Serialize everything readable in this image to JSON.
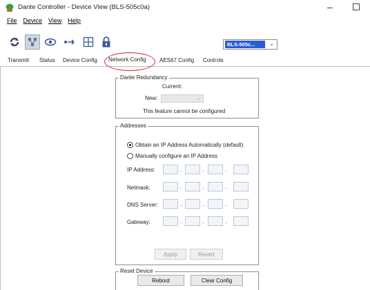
{
  "window": {
    "title": "Dante Controller - Device View (BLS-505c0a)",
    "minimize_glyph": "–"
  },
  "menu": {
    "items": [
      "File",
      "Device",
      "View",
      "Help"
    ]
  },
  "toolbar": {
    "icons": [
      "refresh-icon",
      "network-icon",
      "eye-icon",
      "connection-icon",
      "grid-icon",
      "lock-icon"
    ],
    "device_select_value": "BLS-505c...",
    "device_select_chevron": "⌄"
  },
  "tabs": {
    "items": [
      "Transmit",
      "Status",
      "Device Config",
      "Network Config",
      "AES67 Config",
      "Controls"
    ],
    "active": "Network Config"
  },
  "redundancy": {
    "legend": "Dante Redundancy",
    "current_label": "Current:",
    "new_label": "New:",
    "message": "This feature cannot be configured"
  },
  "addresses": {
    "legend": "Addresses",
    "radio_auto": "Obtain an IP Address Automatically (default)",
    "radio_manual": "Manually configure an IP Address",
    "fields": {
      "ip": "IP Address:",
      "netmask": "Netmask:",
      "dns": "DNS Server:",
      "gateway": "Gateway:"
    },
    "apply": "Apply",
    "revert": "Revert"
  },
  "reset": {
    "legend": "Reset Device",
    "reboot": "Reboot",
    "clear": "Clear Config"
  },
  "colors": {
    "accent_select": "#2a5cd1",
    "highlight_ring": "#d1202a"
  }
}
